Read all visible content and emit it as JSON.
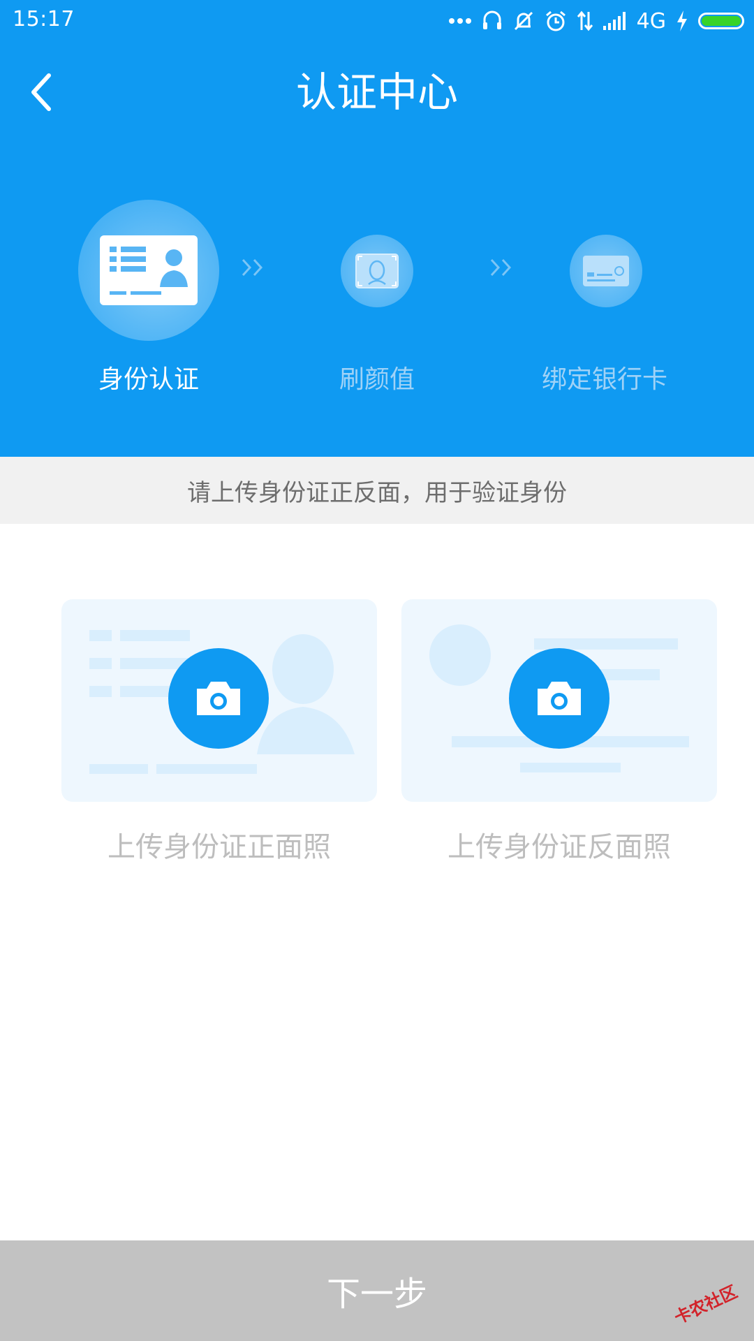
{
  "status_bar": {
    "time": "15:17",
    "network": "4G",
    "icons": [
      "more-dots-icon",
      "headset-icon",
      "mute-icon",
      "alarm-icon",
      "data-arrows-icon",
      "signal-icon",
      "charging-icon",
      "battery-icon"
    ],
    "battery_color": "#38d32a"
  },
  "nav": {
    "title": "认证中心",
    "back_icon": "chevron-left-icon"
  },
  "colors": {
    "primary": "#0f9af2",
    "hint_bg": "#f1f1f1",
    "button_disabled": "#c2c2c2"
  },
  "steps": [
    {
      "label": "身份认证",
      "icon": "id-card-icon",
      "active": true
    },
    {
      "label": "刷颜值",
      "icon": "face-photo-icon",
      "active": false
    },
    {
      "label": "绑定银行卡",
      "icon": "bank-card-icon",
      "active": false
    }
  ],
  "hint": "请上传身份证正反面，用于验证身份",
  "uploads": [
    {
      "label": "上传身份证正面照",
      "icon": "camera-icon"
    },
    {
      "label": "上传身份证反面照",
      "icon": "camera-icon"
    }
  ],
  "next_button": "下一步",
  "watermark": "卡农社区"
}
